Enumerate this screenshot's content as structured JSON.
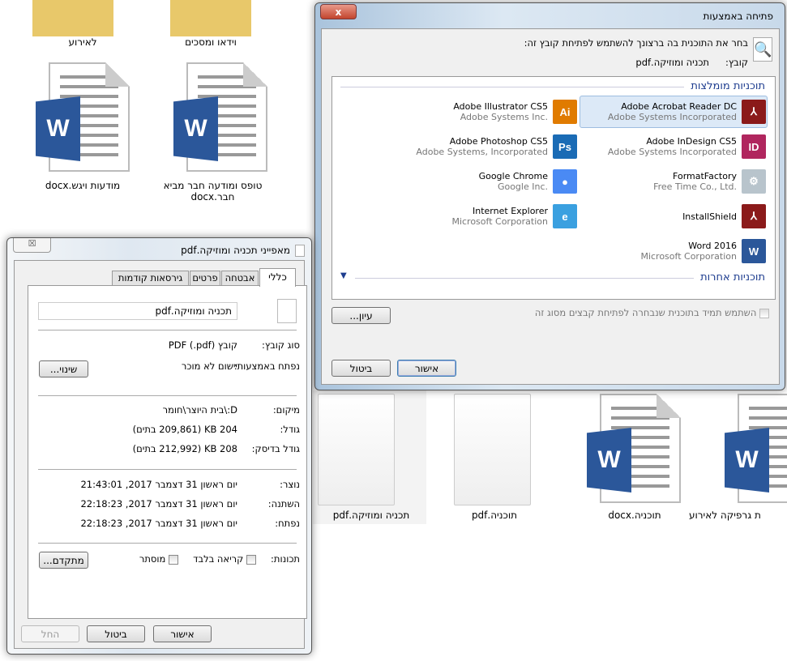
{
  "desktop": {
    "items": [
      {
        "label": "לאירוע",
        "type": "folder"
      },
      {
        "label": "וידאו ומסכים",
        "type": "folder"
      },
      {
        "label": "מודעות ויגש.docx",
        "type": "docx"
      },
      {
        "label": "טופס ומודעה חבר מביא חבר.docx",
        "type": "docx"
      },
      {
        "label": "תכניה ומוזיקה.pdf",
        "type": "pdf"
      },
      {
        "label": "תוכניה.pdf",
        "type": "pdf"
      },
      {
        "label": "תוכניה.docx",
        "type": "docx"
      },
      {
        "label": "ת גרפיקה לאירוע",
        "type": "docx"
      }
    ]
  },
  "open_with": {
    "title": "פתיחה באמצעות",
    "close": "x",
    "instruction": "בחר את התוכנית בה ברצונך להשתמש לפתיחת קובץ זה:",
    "file_label": "קובץ:",
    "file_name": "תכניה ומוזיקה.pdf",
    "recommended_header": "תוכניות מומלצות",
    "other_header": "תוכניות אחרות",
    "apps": [
      {
        "name": "Adobe Acrobat Reader DC",
        "publisher": "Adobe Systems Incorporated",
        "icon": "acrobat-icon",
        "color": "#8b1a1a",
        "glyph": "⅄",
        "selected": true
      },
      {
        "name": "Adobe Illustrator CS5",
        "publisher": "Adobe Systems Inc.",
        "icon": "illustrator-icon",
        "color": "#e07b00",
        "glyph": "Ai"
      },
      {
        "name": "Adobe InDesign CS5",
        "publisher": "Adobe Systems Incorporated",
        "icon": "indesign-icon",
        "color": "#b0265e",
        "glyph": "ID"
      },
      {
        "name": "Adobe Photoshop CS5",
        "publisher": "Adobe Systems, Incorporated",
        "icon": "photoshop-icon",
        "color": "#1a6bb5",
        "glyph": "Ps"
      },
      {
        "name": "FormatFactory",
        "publisher": "Free Time Co., Ltd.",
        "icon": "formatfactory-icon",
        "color": "#b8c4cc",
        "glyph": "⚙"
      },
      {
        "name": "Google Chrome",
        "publisher": "Google Inc.",
        "icon": "chrome-icon",
        "color": "#4a8af4",
        "glyph": "●"
      },
      {
        "name": "InstallShield",
        "publisher": "",
        "icon": "installshield-icon",
        "color": "#8b1a1a",
        "glyph": "⅄"
      },
      {
        "name": "Internet Explorer",
        "publisher": "Microsoft Corporation",
        "icon": "ie-icon",
        "color": "#3aa0e0",
        "glyph": "e"
      },
      {
        "name": "Word 2016",
        "publisher": "Microsoft Corporation",
        "icon": "word-icon",
        "color": "#2b579a",
        "glyph": "W"
      }
    ],
    "always_use": "השתמש תמיד בתוכנית שנבחרה לפתיחת קבצים מסוג זה",
    "browse": "עיון...",
    "ok": "אישור",
    "cancel": "ביטול"
  },
  "properties": {
    "title": "מאפייני תכניה ומוזיקה.pdf",
    "tabs": [
      "כללי",
      "אבטחה",
      "פרטים",
      "גירסאות קודמות"
    ],
    "file_name": "תכניה ומוזיקה.pdf",
    "rows": [
      {
        "label": "סוג קובץ:",
        "value": "קובץ PDF (.pdf)"
      },
      {
        "label": "נפתח באמצעות:",
        "value": "יישום לא מוכר"
      },
      {
        "label": "מיקום:",
        "value": "D:\\בית היוצר\\חומר"
      },
      {
        "label": "גודל:",
        "value": "204 KB (209,861 בתים)"
      },
      {
        "label": "גודל בדיסק:",
        "value": "208 KB (212,992 בתים)"
      },
      {
        "label": "נוצר:",
        "value": "יום ראשון 31 דצמבר 2017, 21:43:01"
      },
      {
        "label": "השתנה:",
        "value": "יום ראשון 31 דצמבר 2017, 22:18:23"
      },
      {
        "label": "נפתח:",
        "value": "יום ראשון 31 דצמבר 2017, 22:18:23"
      }
    ],
    "change": "שינוי...",
    "attributes_label": "תכונות:",
    "readonly": "קריאה בלבד",
    "hidden": "מוסתר",
    "advanced": "מתקדם...",
    "ok": "אישור",
    "cancel": "ביטול",
    "apply": "החל"
  }
}
